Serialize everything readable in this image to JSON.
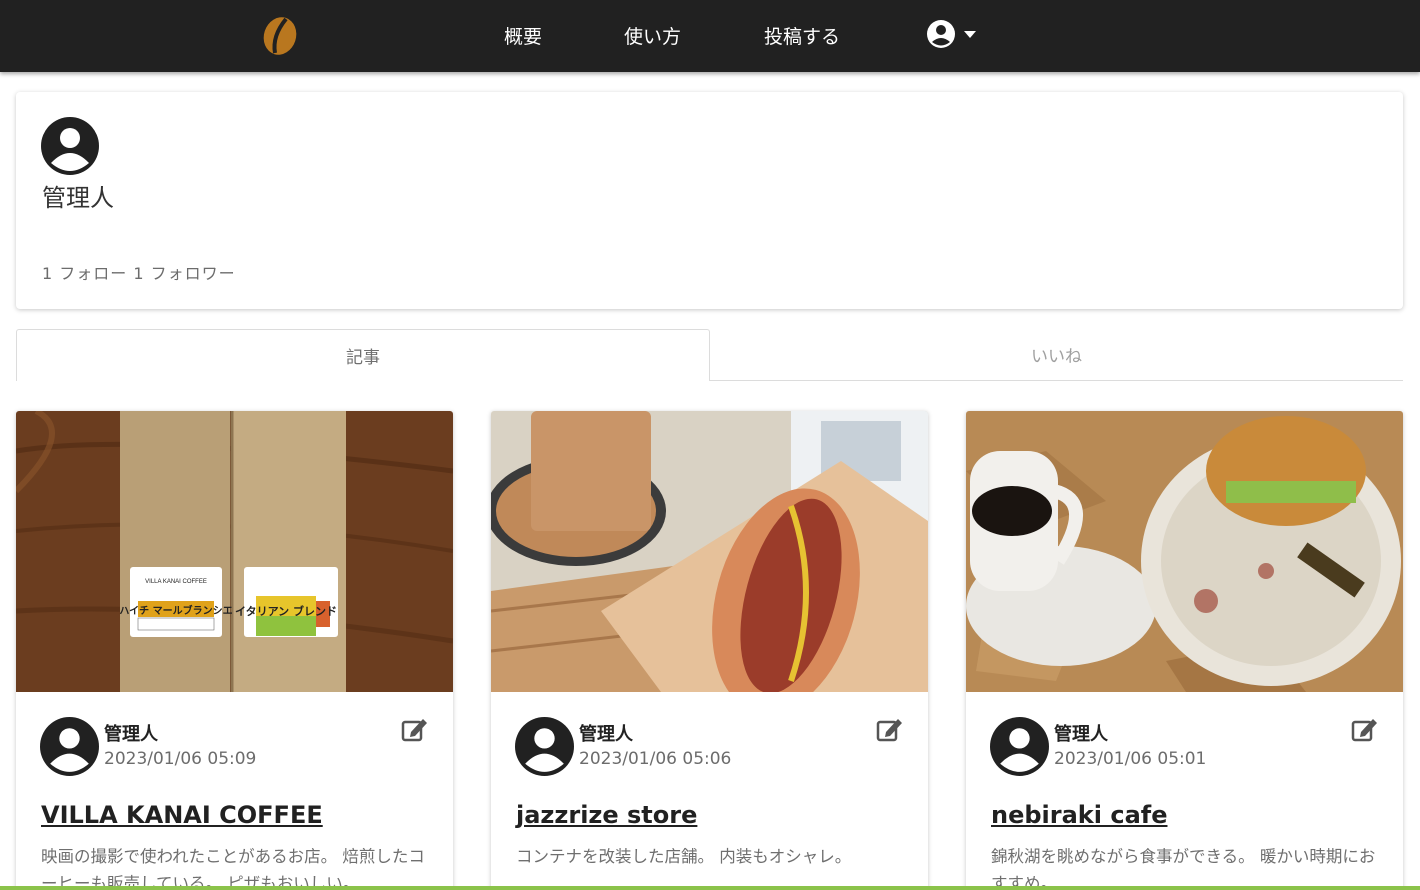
{
  "nav": {
    "links": [
      "概要",
      "使い方",
      "投稿する"
    ],
    "logo_icon": "coffee-bean-icon",
    "user_icon": "account-circle-icon",
    "bg_color": "#212121"
  },
  "profile": {
    "name": "管理人",
    "follow_text": "1 フォロー 1 フォロワー",
    "avatar_icon": "account-circle-icon"
  },
  "tabs": [
    {
      "label": "記事",
      "active": true
    },
    {
      "label": "いいね",
      "active": false
    }
  ],
  "posts": [
    {
      "author": "管理人",
      "date": "2023/01/06 05:09",
      "title": "VILLA KANAI COFFEE",
      "description": "映画の撮影で使われたことがあるお店。 焙煎したコーヒーも販売している。 ピザもおいしい。.",
      "image_subject": "coffee-bean-bags",
      "bag_labels": [
        "VILLA KANAI COFFEE",
        "ハイチ マールブランシエ",
        "イタリアン ブレンド"
      ]
    },
    {
      "author": "管理人",
      "date": "2023/01/06 05:06",
      "title": "jazzrize store",
      "description": "コンテナを改装した店舗。 内装もオシャレ。",
      "image_subject": "hotdog-and-coffee"
    },
    {
      "author": "管理人",
      "date": "2023/01/06 05:01",
      "title": "nebiraki cafe",
      "description": "錦秋湖を眺めながら食事ができる。 暖かい時期におすすめ。",
      "image_subject": "burger-and-coffee"
    }
  ],
  "accent_color": "#8bc34a"
}
